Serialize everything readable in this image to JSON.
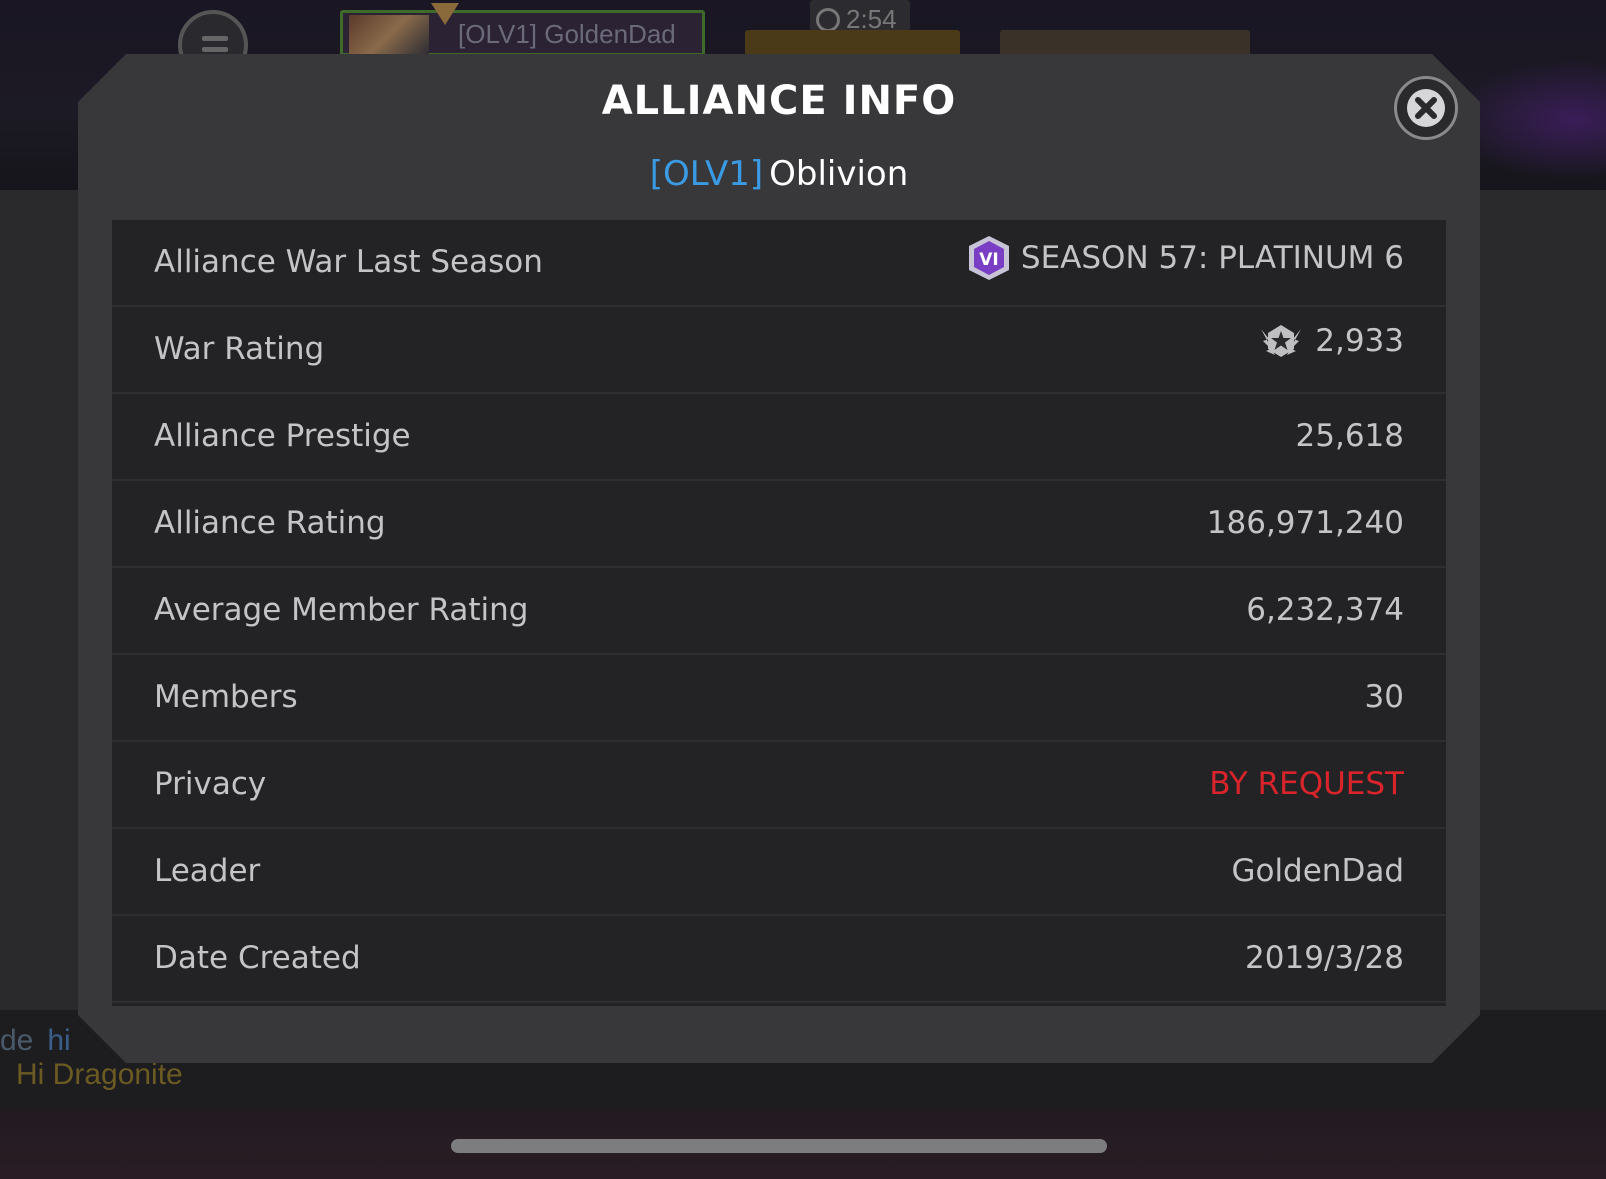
{
  "background": {
    "player_name": "[OLV1] GoldenDad",
    "timer": "2:54",
    "chat_line_1_prefix": "de",
    "chat_line_1_msg": "hi",
    "chat_line_2": "Hi Dragonite"
  },
  "modal": {
    "title": "ALLIANCE INFO",
    "alliance_tag": "[OLV1]",
    "alliance_name": "Oblivion",
    "season_icon_text": "VI",
    "rows": [
      {
        "label": "Alliance War Last Season",
        "value": "SEASON 57: PLATINUM 6"
      },
      {
        "label": "War Rating",
        "value": "2,933"
      },
      {
        "label": "Alliance Prestige",
        "value": "25,618"
      },
      {
        "label": "Alliance Rating",
        "value": "186,971,240"
      },
      {
        "label": "Average Member Rating",
        "value": "6,232,374"
      },
      {
        "label": "Members",
        "value": "30"
      },
      {
        "label": "Privacy",
        "value": "BY REQUEST"
      },
      {
        "label": "Leader",
        "value": "GoldenDad"
      },
      {
        "label": "Date Created",
        "value": "2019/3/28"
      }
    ]
  },
  "colors": {
    "tag_blue": "#3a9be4",
    "privacy_red": "#d8242a",
    "season_purple": "#7a3ec4"
  },
  "icons": [
    "menu-icon",
    "timer-icon",
    "close-icon",
    "war-season-badge-icon",
    "war-rating-icon"
  ]
}
